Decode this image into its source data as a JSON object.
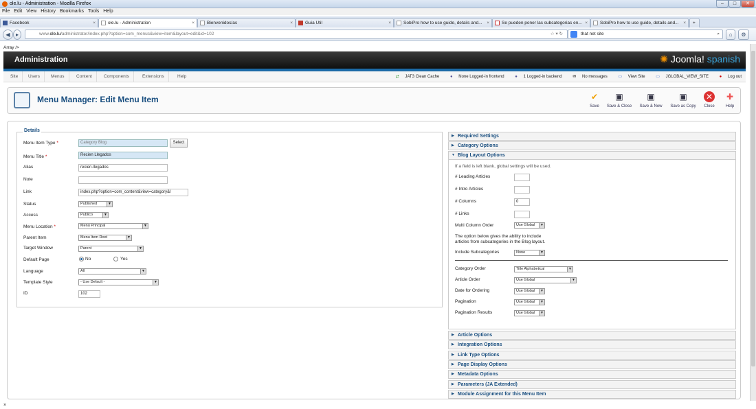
{
  "window": {
    "title": "ole.lu - Administration - Mozilla Firefox"
  },
  "menubar": [
    "File",
    "Edit",
    "View",
    "History",
    "Bookmarks",
    "Tools",
    "Help"
  ],
  "tabs": [
    {
      "label": "Facebook",
      "active": false
    },
    {
      "label": "ole.lu - Administration",
      "active": true
    },
    {
      "label": "Bienvenidos/as",
      "active": false
    },
    {
      "label": "Guia Util",
      "active": false
    },
    {
      "label": "SobiPro how to use guide, details and...",
      "active": false
    },
    {
      "label": "Se pueden poner las subcategorias en...",
      "active": false
    },
    {
      "label": "SobiPro how to use guide, details and...",
      "active": false
    }
  ],
  "nav": {
    "url_prefix": "www.",
    "url_host": "ole.lu",
    "url_rest": "/administrator/index.php?option=com_menus&view=item&layout=edit&id=102",
    "search": "that net site"
  },
  "page": {
    "array_text": "Array />",
    "admin_title": "Administration",
    "logo_main": "Joomla!",
    "logo_sub": "spanish",
    "submenu": [
      "Site",
      "Users",
      "Menus",
      "Content",
      "Components",
      "Extensions",
      "Help"
    ],
    "status": [
      "JAT3 Clean Cache",
      "None Logged-in frontend",
      "1 Logged-in backend",
      "No messages",
      "View Site",
      "JGLOBAL_VIEW_SITE",
      "Log out"
    ],
    "page_title": "Menu Manager: Edit Menu Item",
    "toolbar": [
      "Save",
      "Save & Close",
      "Save & New",
      "Save as Copy",
      "Close",
      "Help"
    ]
  },
  "details": {
    "legend": "Details",
    "menu_item_type_label": "Menu Item Type",
    "menu_item_type_value": "Category Blog",
    "select_button": "Select",
    "menu_title_label": "Menu Title",
    "menu_title_value": "Recien Llegados",
    "alias_label": "Alias",
    "alias_value": "recien-llegados",
    "note_label": "Note",
    "note_value": "",
    "link_label": "Link",
    "link_value": "index.php?option=com_content&view=category&l",
    "status_label": "Status",
    "status_value": "Published",
    "access_label": "Access",
    "access_value": "Publico",
    "menu_location_label": "Menu Location",
    "menu_location_value": "Menú Principal",
    "parent_item_label": "Parent Item",
    "parent_item_value": "Menu Item Root",
    "target_window_label": "Target Window",
    "target_window_value": "Parent",
    "default_page_label": "Default Page",
    "default_no": "No",
    "default_yes": "Yes",
    "language_label": "Language",
    "language_value": "All",
    "template_style_label": "Template Style",
    "template_style_value": "- Use Default -",
    "id_label": "ID",
    "id_value": "102"
  },
  "panes_top": [
    "Required Settings",
    "Category Options",
    "Blog Layout Options"
  ],
  "blog": {
    "note": "If a field is left blank, global settings will be used.",
    "leading_label": "# Leading Articles",
    "intro_label": "# Intro Articles",
    "columns_label": "# Columns",
    "columns_value": "0",
    "links_label": "# Links",
    "multi_col_label": "Multi Column Order",
    "multi_col_value": "Use Global",
    "desc1": "The option below gives the ability to include",
    "desc2": "articles from subcategories in the Blog layout.",
    "include_sub_label": "Include Subcategories",
    "include_sub_value": "None",
    "cat_order_label": "Category Order",
    "cat_order_value": "Title Alphabetical",
    "art_order_label": "Article Order",
    "art_order_value": "Use Global",
    "date_order_label": "Date for Ordering",
    "date_order_value": "Use Global",
    "pagination_label": "Pagination",
    "pagination_value": "Use Global",
    "pag_results_label": "Pagination Results",
    "pag_results_value": "Use Global"
  },
  "panes_bottom": [
    "Article Options",
    "Integration Options",
    "Link Type Options",
    "Page Display Options",
    "Metadata Options",
    "Parameters (JA Extended)",
    "Module Assignment for this Menu Item"
  ],
  "bottom_x": "×"
}
